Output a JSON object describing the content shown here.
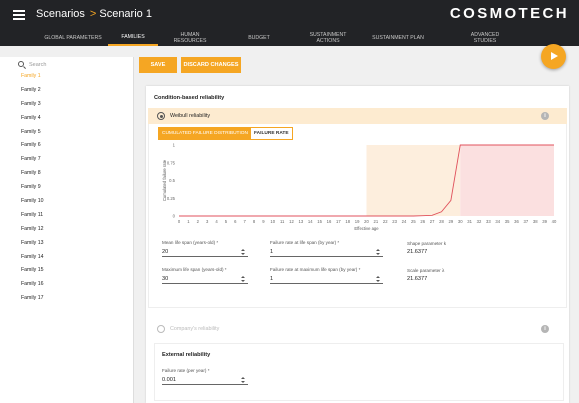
{
  "header": {
    "breadcrumb_root": "Scenarios",
    "breadcrumb_separator": ">",
    "breadcrumb_current": "Scenario 1",
    "logo": "COSMOTECH"
  },
  "tabs": [
    {
      "label": "GLOBAL PARAMETERS",
      "active": false
    },
    {
      "label": "FAMILIES",
      "active": true
    },
    {
      "label": "HUMAN RESOURCES",
      "active": false
    },
    {
      "label": "BUDGET",
      "active": false
    },
    {
      "label": "SUSTAINMENT ACTIONS",
      "active": false
    },
    {
      "label": "SUSTAINMENT PLAN",
      "active": false
    },
    {
      "label": "ADVANCED STUDIES",
      "active": false
    }
  ],
  "sidebar": {
    "search_placeholder": "Search",
    "families": [
      "Family 1",
      "Family 2",
      "Family 3",
      "Family 4",
      "Family 5",
      "Family 6",
      "Family 7",
      "Family 8",
      "Family 9",
      "Family 10",
      "Family 11",
      "Family 12",
      "Family 13",
      "Family 14",
      "Family 15",
      "Family 16",
      "Family 17"
    ],
    "selected_index": 0
  },
  "actions": {
    "save": "SAVE",
    "discard": "DISCARD CHANGES"
  },
  "condition_based": {
    "title": "Condition-based reliability",
    "weibull": {
      "label": "Weibull reliability",
      "selected": true,
      "chart_tabs": [
        {
          "label": "CUMULATED FAILURE DISTRIBUTION",
          "active": true
        },
        {
          "label": "FAILURE RATE",
          "active": false
        }
      ],
      "fields": {
        "mean_life_span": {
          "label": "Mean life span (years-old) *",
          "value": "20"
        },
        "failure_rate_life_span": {
          "label": "Failure rate at life span (by year) *",
          "value": "1"
        },
        "max_life_span": {
          "label": "Maximum life span (years-old) *",
          "value": "30"
        },
        "failure_rate_max_life_span": {
          "label": "Failure rate at maximum life span (by year) *",
          "value": "1"
        }
      },
      "shape_parameter": {
        "label": "Shape parameter k",
        "value": "21.6377"
      },
      "scale_parameter": {
        "label": "Scale parameter λ",
        "value": "21.6377"
      }
    },
    "company": {
      "label": "Company's reliability",
      "selected": false
    }
  },
  "external": {
    "title": "External reliability",
    "failure_rate": {
      "label": "Failure rate (per year) *",
      "value": "0.001"
    }
  },
  "chart_data": {
    "type": "line",
    "title": "",
    "xlabel": "Effective age",
    "ylabel": "Cumulated failure rate",
    "xlim": [
      0,
      40
    ],
    "ylim": [
      0,
      1
    ],
    "x_ticks": [
      0,
      1,
      2,
      3,
      4,
      5,
      6,
      7,
      8,
      9,
      10,
      11,
      12,
      13,
      14,
      15,
      16,
      17,
      18,
      19,
      20,
      21,
      22,
      23,
      24,
      25,
      26,
      27,
      28,
      29,
      30,
      31,
      32,
      33,
      34,
      35,
      36,
      37,
      38,
      39,
      40
    ],
    "y_ticks": [
      "0",
      "0.25",
      "0.5",
      "0.75",
      "1"
    ],
    "grid": false,
    "shaded_regions": [
      {
        "x0": 20,
        "x1": 30,
        "color": "#fdeedd"
      },
      {
        "x0": 30,
        "x1": 40,
        "color": "#fbe0e0"
      }
    ],
    "series": [
      {
        "color": "#e0525c",
        "x": [
          0,
          1,
          2,
          3,
          4,
          5,
          6,
          7,
          8,
          9,
          10,
          11,
          12,
          13,
          14,
          15,
          16,
          17,
          18,
          19,
          20,
          21,
          22,
          23,
          24,
          25,
          26,
          27,
          28,
          29,
          30,
          31,
          32,
          33,
          34,
          35,
          36,
          37,
          38,
          39,
          40
        ],
        "y": [
          0,
          0,
          0,
          0,
          0,
          0,
          0,
          0,
          0,
          0,
          0,
          0,
          0,
          0,
          0,
          0,
          0,
          0,
          0,
          0,
          0,
          0,
          0,
          0,
          0,
          0,
          0.005,
          0.01,
          0.06,
          0.22,
          1,
          1,
          1,
          1,
          1,
          1,
          1,
          1,
          1,
          1,
          1
        ]
      }
    ]
  }
}
